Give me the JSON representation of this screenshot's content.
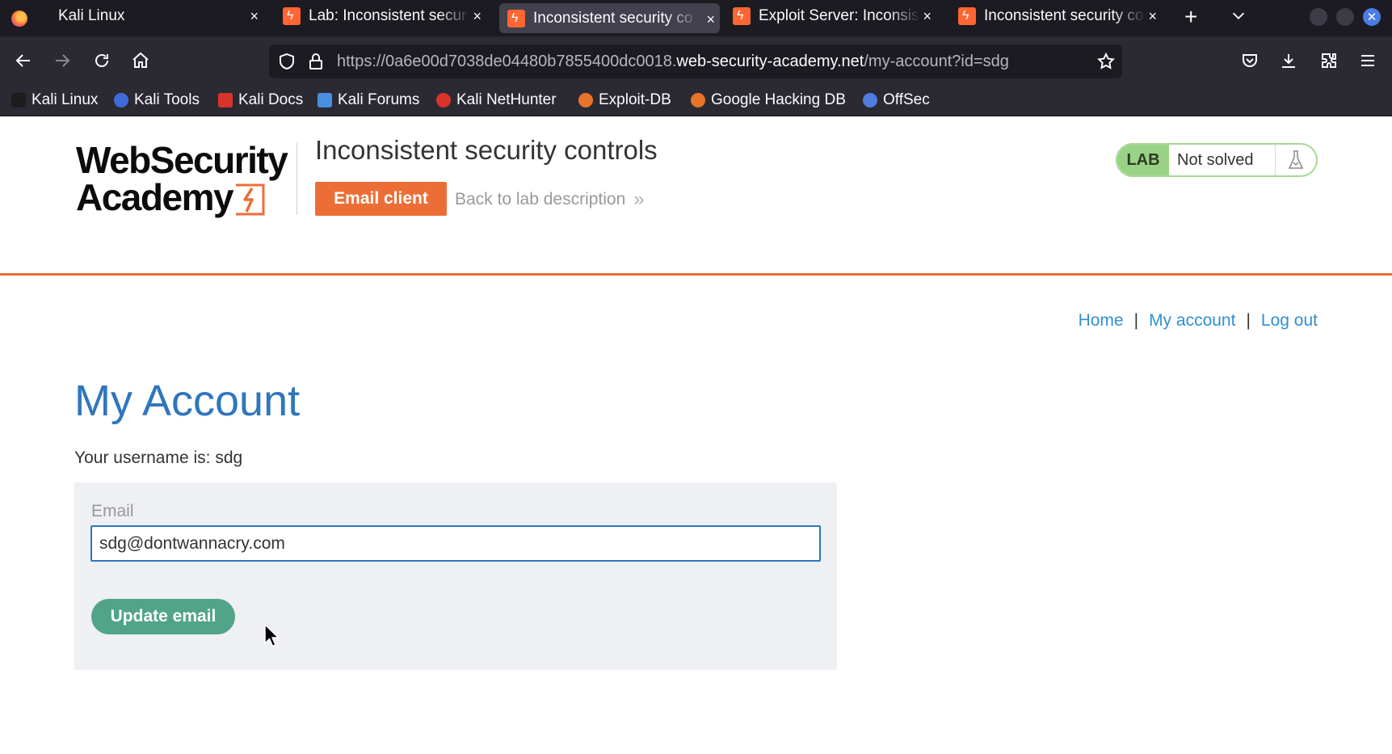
{
  "browser": {
    "tabs": [
      {
        "title": "Kali Linux",
        "active": false
      },
      {
        "title": "Lab: Inconsistent secur",
        "active": false
      },
      {
        "title": "Inconsistent security co",
        "active": true
      },
      {
        "title": "Exploit Server: Inconsis",
        "active": false
      },
      {
        "title": "Inconsistent security co",
        "active": false
      }
    ],
    "tab_close_glyph": "×",
    "new_tab_glyph": "+",
    "url": {
      "prefix": "https://0a6e00d7038de04480b7855400dc0018.",
      "host": "web-security-academy.net",
      "path": "/my-account?id=sdg"
    },
    "bookmarks": [
      {
        "label": "Kali Linux",
        "icon": "kali-dragon-icon",
        "color": "#1d1d1d"
      },
      {
        "label": "Kali Tools",
        "icon": "kali-tools-icon",
        "color": "#3f6bd8"
      },
      {
        "label": "Kali Docs",
        "icon": "kali-docs-icon",
        "color": "#d9342b"
      },
      {
        "label": "Kali Forums",
        "icon": "kali-forums-icon",
        "color": "#4a8ee0"
      },
      {
        "label": "Kali NetHunter",
        "icon": "nethunter-icon",
        "color": "#d9342b"
      },
      {
        "label": "Exploit-DB",
        "icon": "exploit-db-icon",
        "color": "#e8742a"
      },
      {
        "label": "Google Hacking DB",
        "icon": "ghdb-icon",
        "color": "#e8742a"
      },
      {
        "label": "OffSec",
        "icon": "offsec-icon",
        "color": "#4f7de0"
      }
    ]
  },
  "page": {
    "logo": {
      "line1": "WebSecurity",
      "line2": "Academy"
    },
    "lab_title": "Inconsistent security controls",
    "email_client_label": "Email client",
    "back_link_label": "Back to lab description",
    "back_link_chevron": "»",
    "lab_badge": {
      "tag": "LAB",
      "status": "Not solved"
    },
    "nav": {
      "home": "Home",
      "my_account": "My account",
      "log_out": "Log out",
      "separator": "|"
    },
    "heading": "My Account",
    "username_line": "Your username is: sdg",
    "form": {
      "email_label": "Email",
      "email_value": "sdg@dontwannacry.com",
      "submit_label": "Update email"
    }
  },
  "colors": {
    "accent_orange": "#ec6e36",
    "heading_blue": "#2f76bd",
    "link_blue": "#2f90d1",
    "button_green": "#51a488",
    "lab_green": "#9ad285"
  }
}
